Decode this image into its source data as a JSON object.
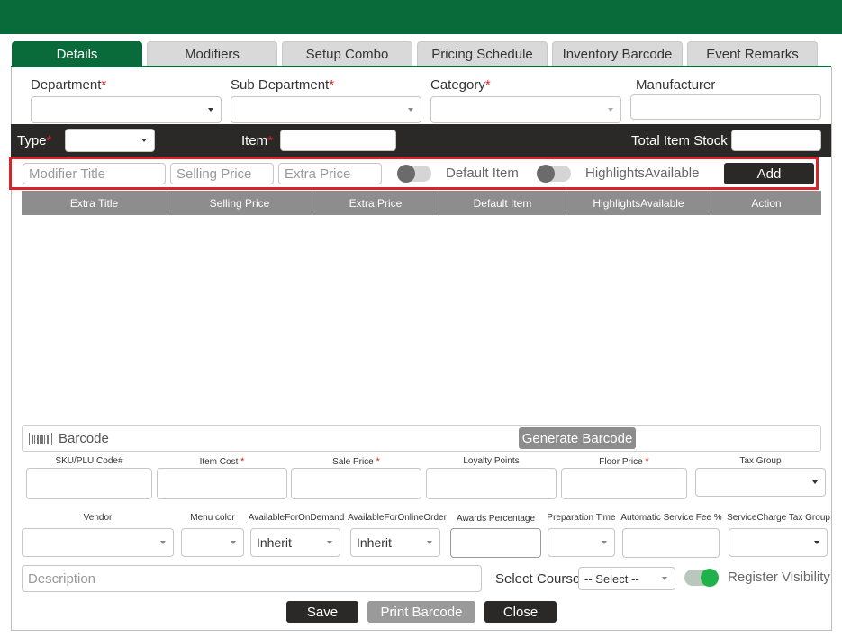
{
  "tabs": [
    "Details",
    "Modifiers",
    "Setup Combo",
    "Pricing Schedule",
    "Inventory Barcode",
    "Event Remarks"
  ],
  "fields": {
    "department_label": "Department",
    "sub_department_label": "Sub Department",
    "category_label": "Category",
    "manufacturer_label": "Manufacturer",
    "required_mark": "*"
  },
  "item_bar": {
    "type_label": "Type",
    "item_label": "Item",
    "total_stock_label": "Total Item Stock"
  },
  "modifier_row": {
    "title_placeholder": "Modifier Title",
    "selling_price_placeholder": "Selling Price",
    "extra_price_placeholder": "Extra Price",
    "default_item_label": "Default Item",
    "highlights_label": "HighlightsAvailable",
    "add_label": "Add"
  },
  "table": {
    "columns": [
      "Extra Title",
      "Selling Price",
      "Extra Price",
      "Default Item",
      "HighlightsAvailable",
      "Action"
    ]
  },
  "barcode": {
    "label": "Barcode",
    "generate_label": "Generate Barcode"
  },
  "row1": {
    "sku_label": "SKU/PLU Code#",
    "item_cost_label": "Item Cost",
    "sale_price_label": "Sale Price",
    "loyalty_label": "Loyalty Points",
    "floor_price_label": "Floor Price",
    "tax_group_label": "Tax Group"
  },
  "row2": {
    "vendor_label": "Vendor",
    "menu_color_label": "Menu color",
    "on_demand_label": "AvailableForOnDemand",
    "on_demand_value": "Inherit",
    "online_order_label": "AvailableForOnlineOrder",
    "online_order_value": "Inherit",
    "awards_label": "Awards Percentage",
    "prep_time_label": "Preparation Time",
    "service_fee_label": "Automatic Service Fee %",
    "service_tax_label": "ServiceCharge Tax Group"
  },
  "bottom": {
    "description_placeholder": "Description",
    "select_course_label": "Select Course",
    "select_course_value": "-- Select --",
    "register_visibility_label": "Register Visibility"
  },
  "actions": {
    "save_label": "Save",
    "print_barcode_label": "Print Barcode",
    "close_label": "Close"
  },
  "colors": {
    "brand_green": "#0a6b3a",
    "dark": "#2b2828",
    "required_red": "#d9232a",
    "toggle_on": "#1fb24a"
  }
}
